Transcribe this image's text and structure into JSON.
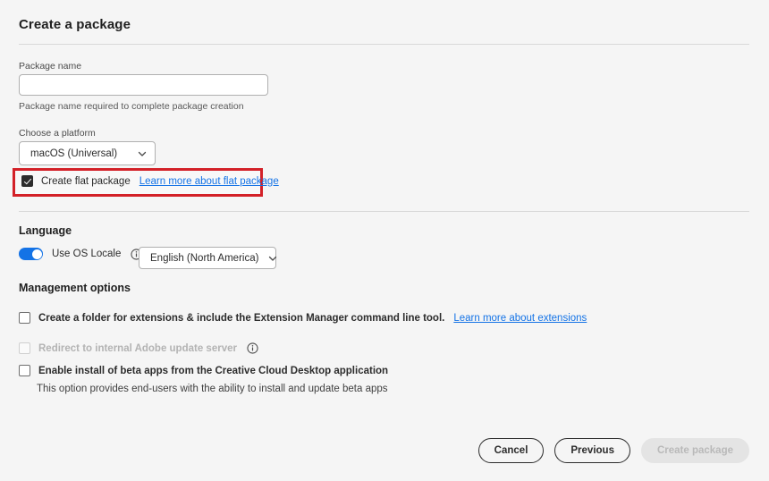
{
  "page": {
    "title": "Create a package"
  },
  "package_name": {
    "label": "Package name",
    "value": "",
    "placeholder": "",
    "helper": "Package name required to complete package creation"
  },
  "platform": {
    "label": "Choose a platform",
    "selected": "macOS (Universal)"
  },
  "flat_package": {
    "label": "Create flat package",
    "checked": true,
    "link": "Learn more about flat package",
    "highlight_color": "#d32128"
  },
  "language": {
    "title": "Language",
    "toggle_label": "Use OS Locale",
    "toggle_on": true,
    "toggle_color": "#1473e6",
    "selected": "English (North America)"
  },
  "management": {
    "title": "Management options",
    "options": [
      {
        "label": "Create a folder for extensions & include the Extension Manager command line tool.",
        "checked": false,
        "disabled": false,
        "link": "Learn more about extensions"
      },
      {
        "label": "Redirect to internal Adobe update server",
        "checked": false,
        "disabled": true,
        "link": ""
      },
      {
        "label": "Enable install of beta apps from the Creative Cloud Desktop application",
        "checked": false,
        "disabled": false,
        "link": "",
        "description": "This option provides end-users with the ability to install and update beta apps"
      }
    ]
  },
  "footer": {
    "cancel": "Cancel",
    "previous": "Previous",
    "create": "Create package"
  },
  "colors": {
    "link": "#1473e6",
    "background": "#f5f5f5"
  }
}
